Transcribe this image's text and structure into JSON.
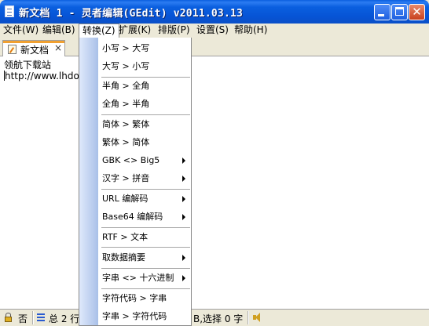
{
  "window": {
    "title": "新文档 1 - 灵者编辑(GEdit) v2011.03.13"
  },
  "menubar": [
    {
      "label": "文件(W)",
      "name": "menu-file"
    },
    {
      "label": "编辑(B)",
      "name": "menu-edit"
    },
    {
      "label": "转换(Z)",
      "name": "menu-convert"
    },
    {
      "label": "扩展(K)",
      "name": "menu-extend"
    },
    {
      "label": "排版(P)",
      "name": "menu-layout"
    },
    {
      "label": "设置(S)",
      "name": "menu-settings"
    },
    {
      "label": "帮助(H)",
      "name": "menu-help"
    }
  ],
  "tab": {
    "label": "新文档",
    "close": "×"
  },
  "editor": {
    "lines": [
      "领航下载站",
      "http://www.lhdown"
    ]
  },
  "convert_menu": {
    "items": [
      {
        "label": "小写 > 大写",
        "submenu": false
      },
      {
        "label": "大写 > 小写",
        "submenu": false
      },
      {
        "label": "半角 > 全角",
        "submenu": false
      },
      {
        "label": "全角 > 半角",
        "submenu": false
      },
      {
        "label": "简体 > 繁体",
        "submenu": false
      },
      {
        "label": "繁体 > 简体",
        "submenu": false
      },
      {
        "label": "GBK <> Big5",
        "submenu": true
      },
      {
        "label": "汉字 > 拼音",
        "submenu": true
      },
      {
        "label": "URL 编解码",
        "submenu": true
      },
      {
        "label": "Base64 编解码",
        "submenu": true
      },
      {
        "label": "RTF > 文本",
        "submenu": false
      },
      {
        "label": "取数据摘要",
        "submenu": true
      },
      {
        "label": "字串 <> 十六进制",
        "submenu": true
      },
      {
        "label": "字符代码 > 字串",
        "submenu": false
      },
      {
        "label": "字串 > 字符代码",
        "submenu": false
      }
    ]
  },
  "statusbar": {
    "readonly": "否",
    "total_prefix": "总 2 行",
    "selection": "B,选择 0 字"
  }
}
